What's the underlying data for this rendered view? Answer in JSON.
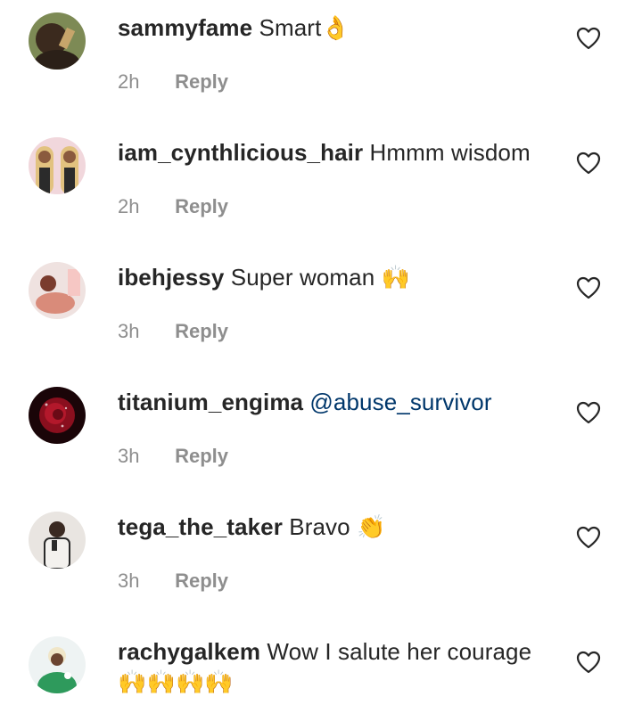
{
  "comments": [
    {
      "username": "sammyfame",
      "text": "Smart",
      "emoji": "👌",
      "time": "2h",
      "reply_label": "Reply",
      "avatar_colors": [
        "#6b5a3a",
        "#2c2118"
      ]
    },
    {
      "username": "iam_cynthlicious_hair",
      "text": "Hmmm wisdom",
      "emoji": "",
      "time": "2h",
      "reply_label": "Reply",
      "avatar_colors": [
        "#e9b9c4",
        "#c99c6c"
      ]
    },
    {
      "username": "ibehjessy",
      "text": "Super woman",
      "emoji": "🙌",
      "time": "3h",
      "reply_label": "Reply",
      "avatar_colors": [
        "#e8d5d0",
        "#b06c62"
      ]
    },
    {
      "username": "titanium_engima",
      "text": "",
      "mention": "@abuse_survivor",
      "emoji": "",
      "time": "3h",
      "reply_label": "Reply",
      "avatar_colors": [
        "#3a0b10",
        "#9c1424"
      ]
    },
    {
      "username": "tega_the_taker",
      "text": "Bravo",
      "emoji": "👏",
      "time": "3h",
      "reply_label": "Reply",
      "avatar_colors": [
        "#d8d4d0",
        "#2a2a2a"
      ]
    },
    {
      "username": "rachygalkem",
      "text": "Wow I salute her courage",
      "emoji": "🙌🙌🙌🙌",
      "time": "",
      "reply_label": "",
      "avatar_colors": [
        "#e6eef0",
        "#2a8a55"
      ]
    }
  ],
  "colors": {
    "text": "#262626",
    "meta": "#8e8e8e",
    "mention": "#00376b",
    "emoji_yellow": "#f6c031"
  },
  "icons": {
    "like": "heart-outline-icon"
  }
}
